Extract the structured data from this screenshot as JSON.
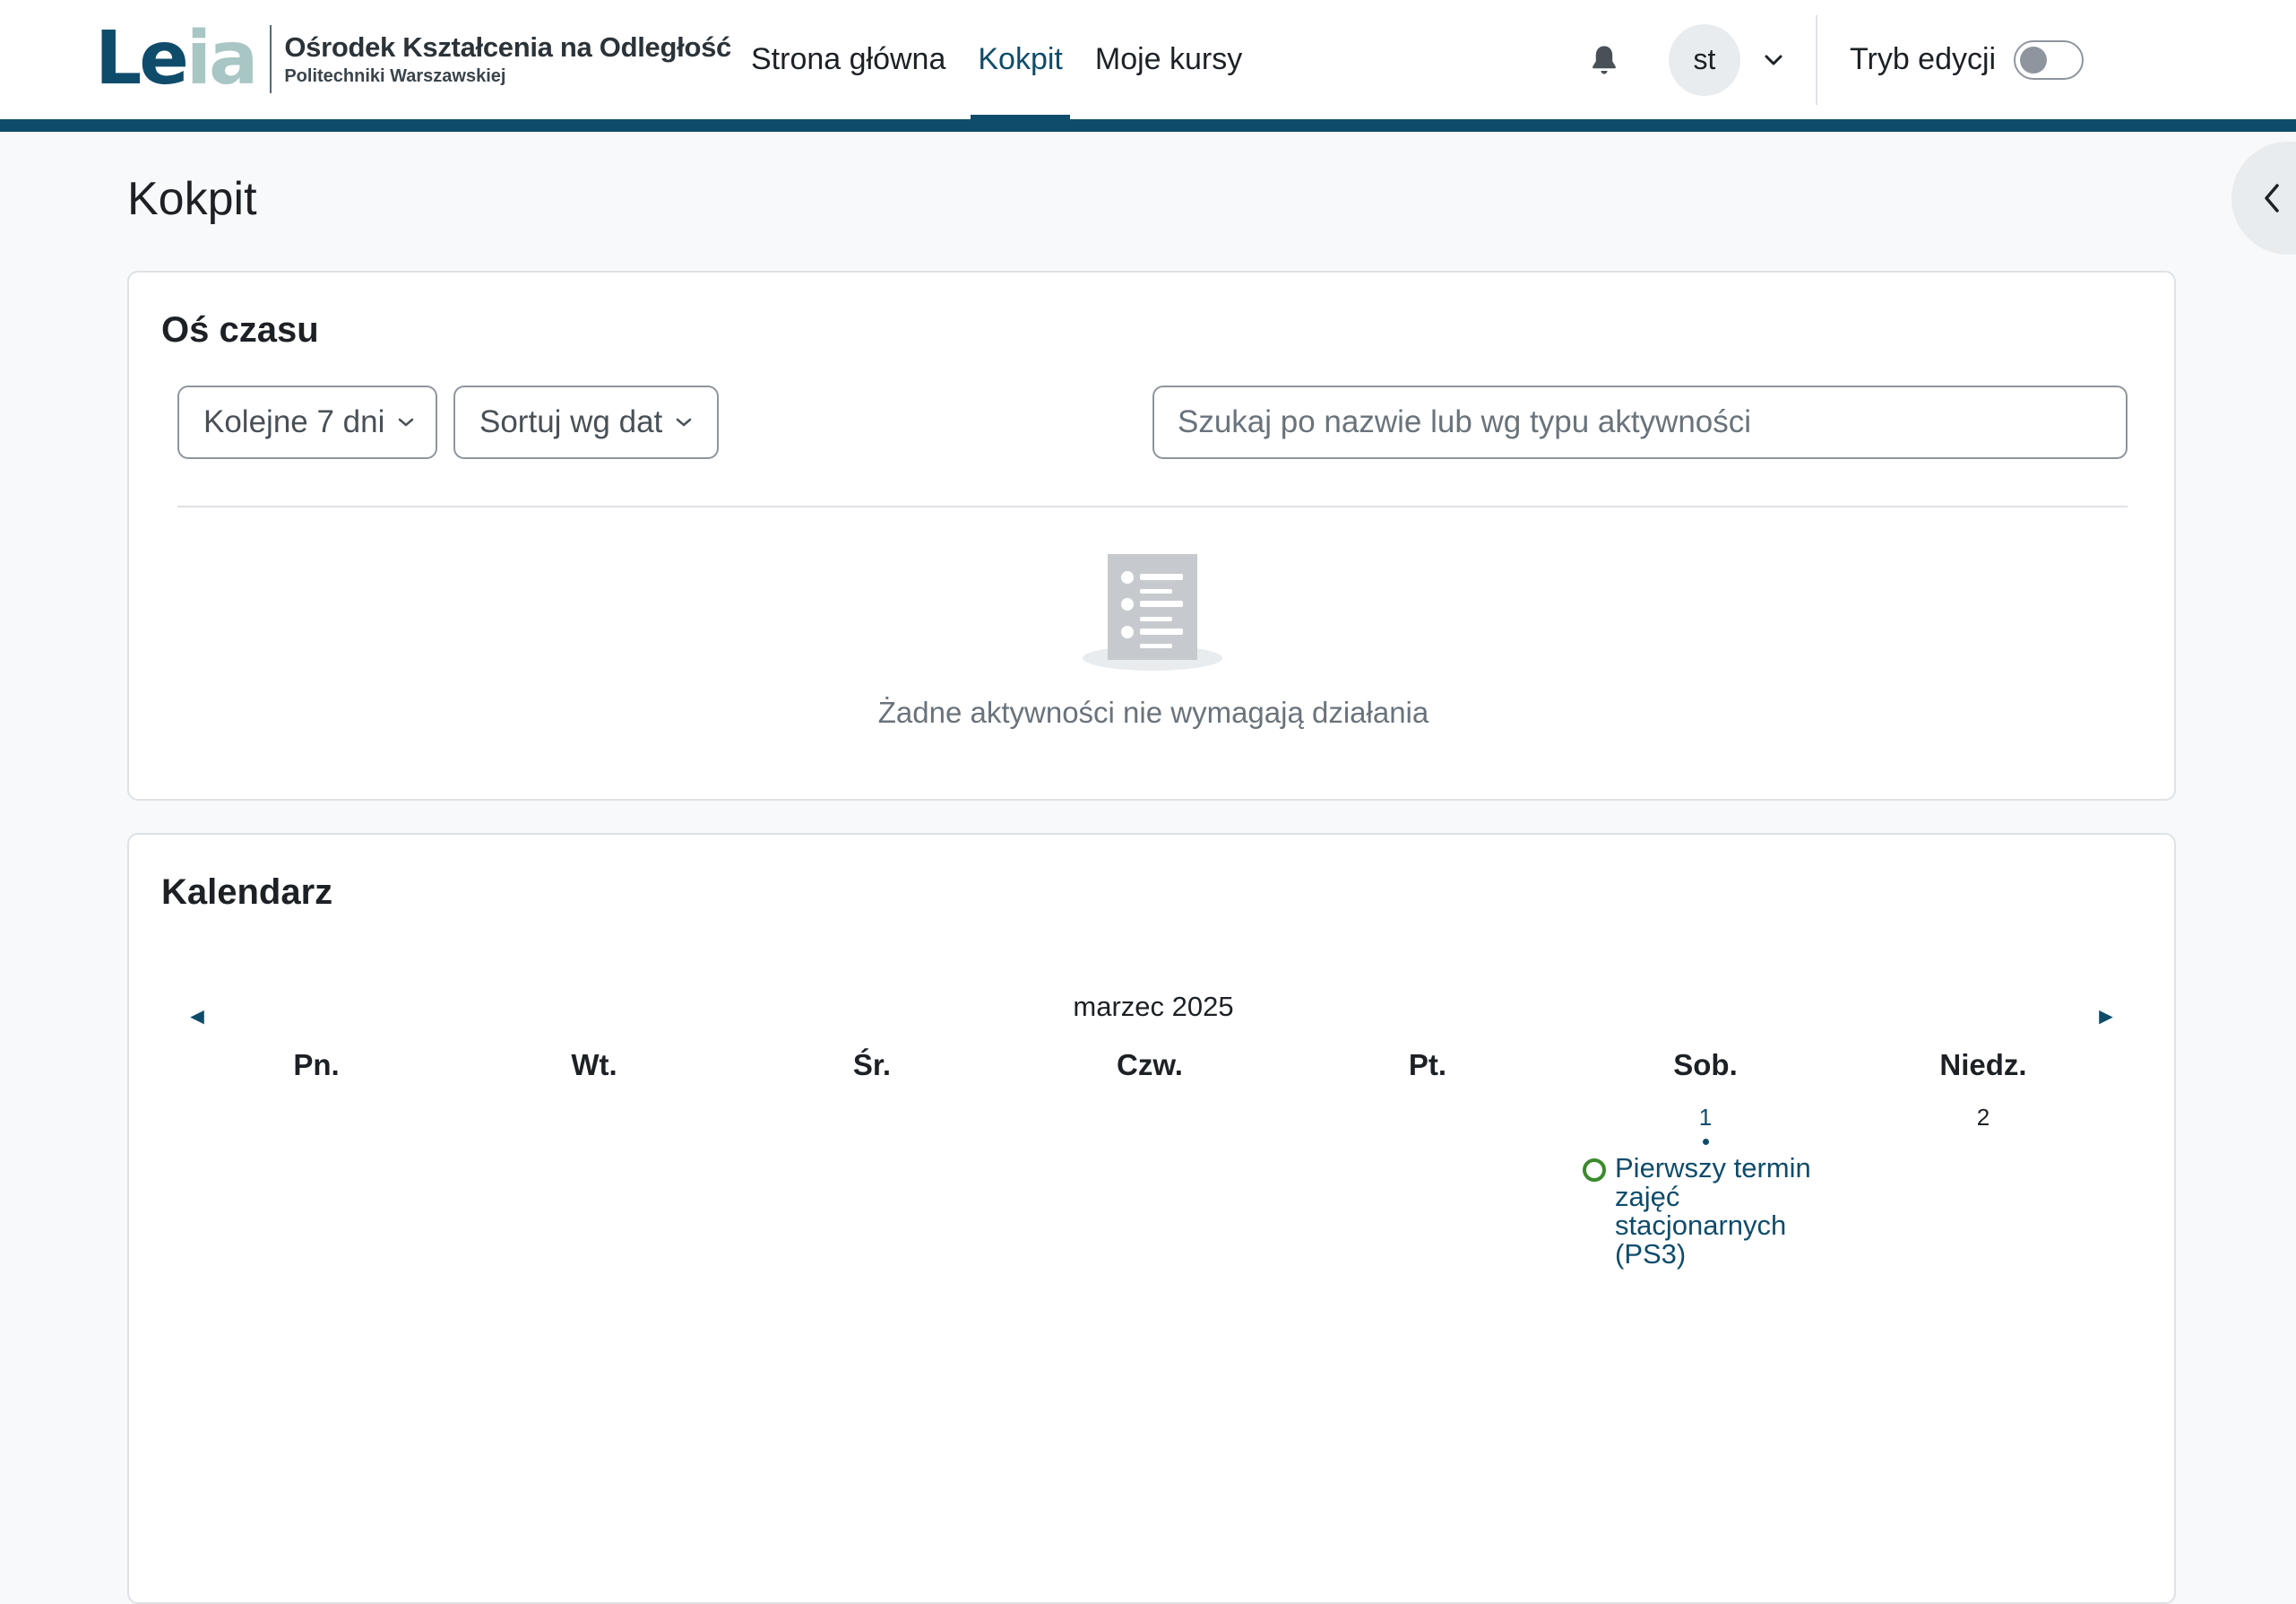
{
  "brand": {
    "logo_left": "Le",
    "logo_right": "ia",
    "title": "Ośrodek Kształcenia na Odległość",
    "subtitle": "Politechniki Warszawskiej"
  },
  "nav": {
    "links": [
      {
        "label": "Strona główna",
        "active": false
      },
      {
        "label": "Kokpit",
        "active": true
      },
      {
        "label": "Moje kursy",
        "active": false
      }
    ],
    "user_initials": "st",
    "edit_mode_label": "Tryb edycji",
    "edit_mode_on": false
  },
  "page": {
    "title": "Kokpit"
  },
  "timeline": {
    "title": "Oś czasu",
    "range_label": "Kolejne 7 dni",
    "sort_label": "Sortuj wg dat",
    "search_placeholder": "Szukaj po nazwie lub wg typu aktywności",
    "empty_message": "Żadne aktywności nie wymagają działania"
  },
  "calendar": {
    "title": "Kalendarz",
    "month": "marzec 2025",
    "prev_symbol": "◄",
    "next_symbol": "►",
    "weekdays": [
      "Pn.",
      "Wt.",
      "Śr.",
      "Czw.",
      "Pt.",
      "Sob.",
      "Niedz."
    ],
    "days": [
      {
        "day": "1",
        "has_event": true,
        "event": "Pierwszy termin zajęć stacjonarnych (PS3)"
      },
      {
        "day": "2",
        "has_event": false
      }
    ]
  },
  "colors": {
    "brand": "#0f4c6b",
    "brand_light": "#a8c6c4",
    "event_icon": "#3a8a2c"
  },
  "icons": {
    "bell": "bell-icon",
    "chevron": "chevron-down-icon",
    "drawer": "chevron-left-icon",
    "empty": "list-document-icon"
  }
}
